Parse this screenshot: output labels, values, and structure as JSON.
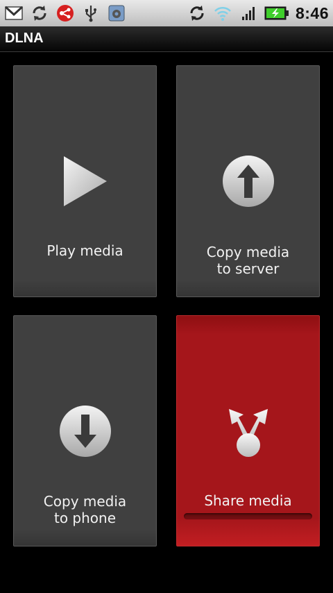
{
  "status_bar": {
    "time": "8:46",
    "icons": [
      "gmail-icon",
      "sync-icon",
      "media-share-icon",
      "usb-icon",
      "settings-icon",
      "sync-icon",
      "wifi-icon",
      "signal-icon",
      "battery-charging-icon"
    ]
  },
  "app": {
    "title": "DLNA"
  },
  "tiles": [
    {
      "label": "Play media",
      "icon": "play-icon"
    },
    {
      "label": "Copy media\nto server",
      "icon": "upload-arrow-icon"
    },
    {
      "label": "Copy media\nto phone",
      "icon": "download-arrow-icon"
    },
    {
      "label": "Share media",
      "icon": "share-icon",
      "selected": true
    }
  ],
  "colors": {
    "tile_bg": "#404040",
    "selected_tile_bg": "#a5161b",
    "status_bar_bg": "#d4d4d4",
    "title_bar_bg": "#1a1a1a"
  }
}
